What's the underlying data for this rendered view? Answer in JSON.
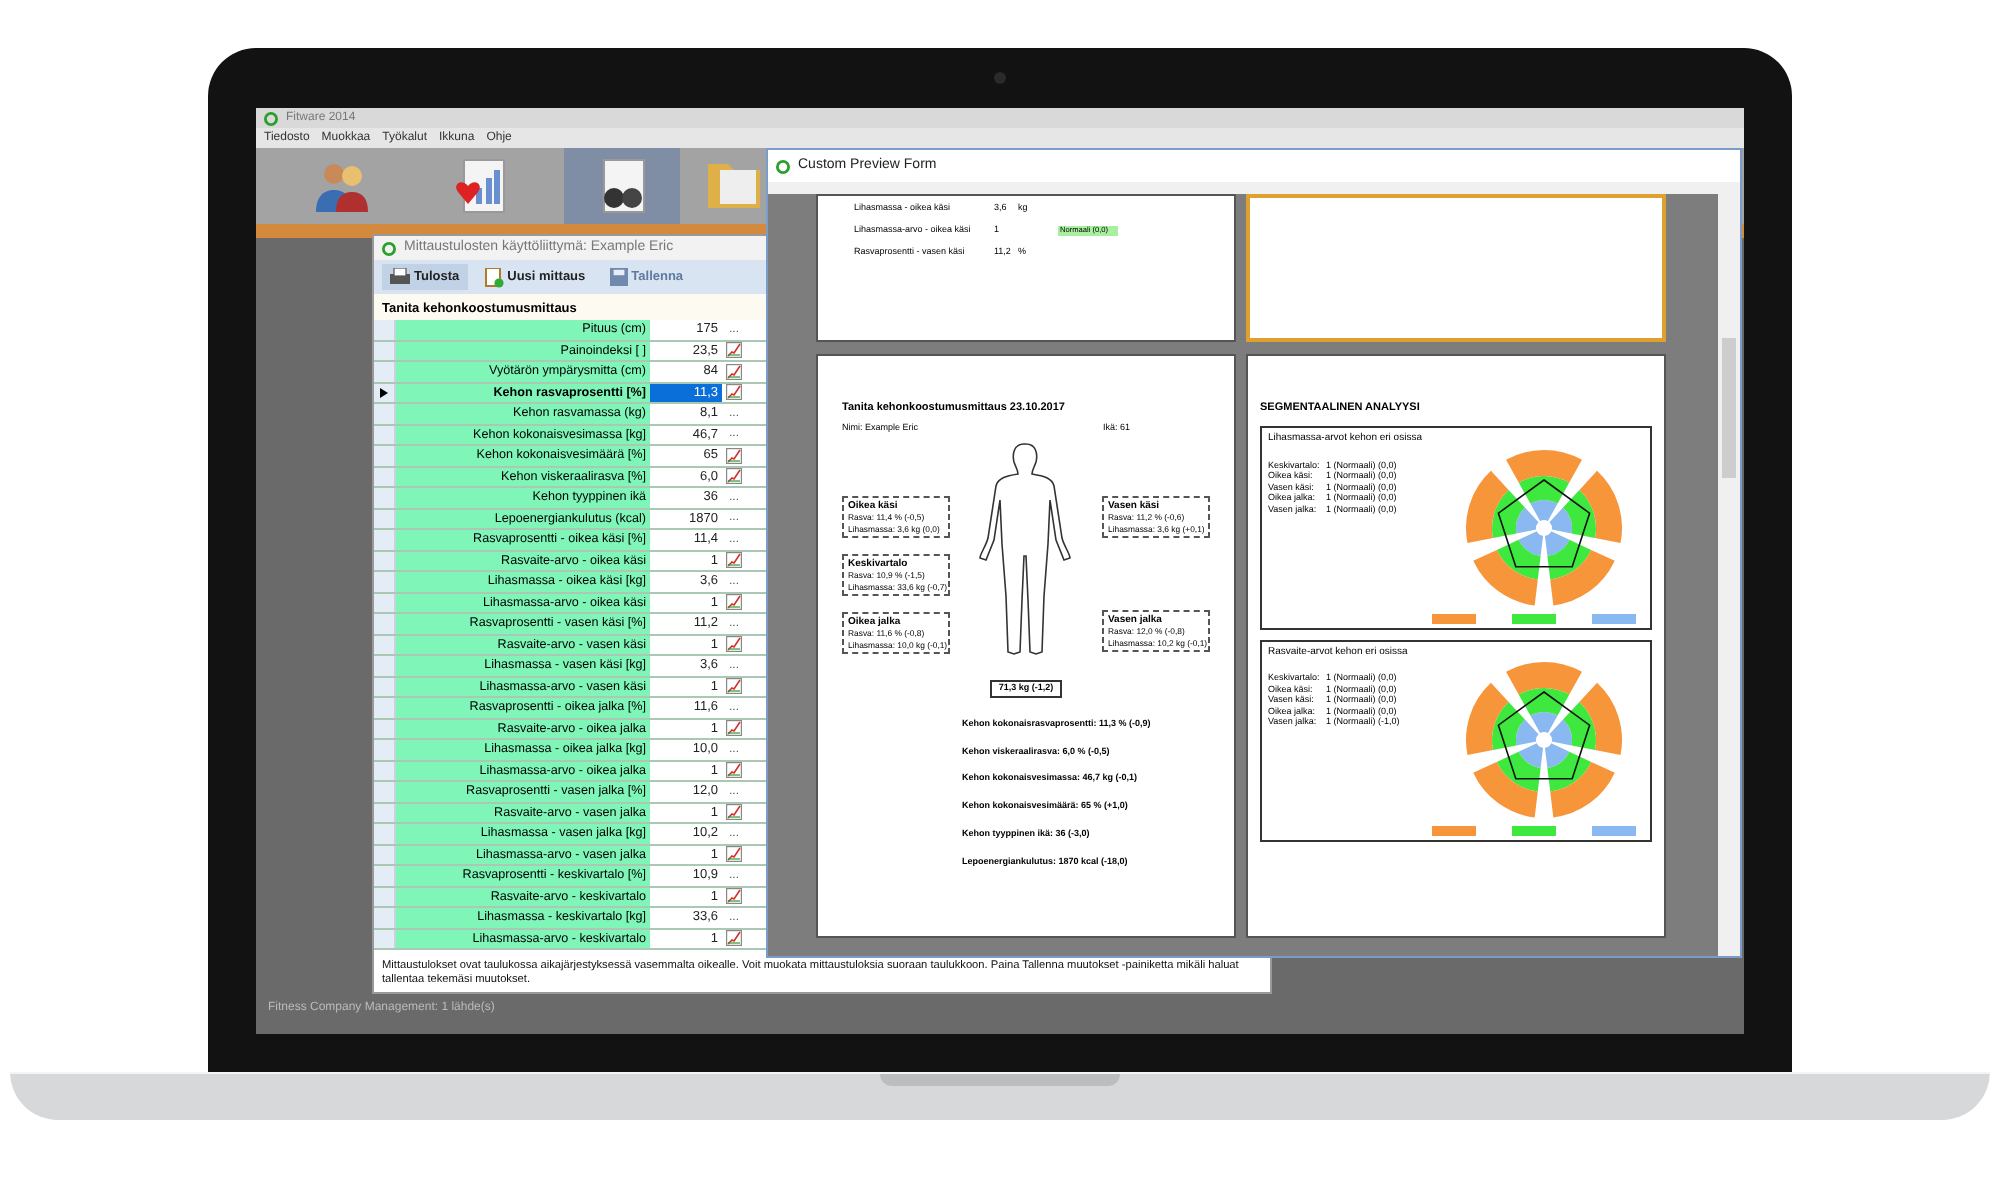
{
  "app": {
    "title": "Fitware 2014",
    "menu": [
      "Tiedosto",
      "Muokkaa",
      "Työkalut",
      "Ikkuna",
      "Ohje"
    ]
  },
  "ribbon": [
    {
      "kind": "people",
      "selected": false
    },
    {
      "kind": "heart-chart",
      "selected": false
    },
    {
      "kind": "weights",
      "selected": true
    },
    {
      "kind": "folder",
      "selected": false
    }
  ],
  "measure_window": {
    "title": "Mittaustulosten käyttöliittymä: Example Eric",
    "toolbar": [
      {
        "kind": "printer",
        "label": "Tulosta",
        "disabled": false
      },
      {
        "kind": "new",
        "label": "Uusi mittaus",
        "disabled": false
      },
      {
        "kind": "save",
        "label": "Tallenna",
        "disabled": true
      }
    ],
    "section": "Tanita kehonkoostumusmittaus",
    "rows": [
      {
        "label": "Pituus (cm)",
        "value": "175",
        "kind": "more",
        "more": "...",
        "selected": false
      },
      {
        "label": "Painoindeksi [ ]",
        "value": "23,5",
        "kind": "chart",
        "selected": false
      },
      {
        "label": "Vyötärön ympärysmitta (cm)",
        "value": "84",
        "kind": "chart",
        "selected": false
      },
      {
        "label": "Kehon rasvaprosentti [%]",
        "value": "11,3",
        "kind": "chart",
        "selected": true
      },
      {
        "label": "Kehon rasvamassa (kg)",
        "value": "8,1",
        "kind": "more",
        "more": "...",
        "selected": false
      },
      {
        "label": "Kehon kokonaisvesimassa [kg]",
        "value": "46,7",
        "kind": "more",
        "more": "...",
        "selected": false
      },
      {
        "label": "Kehon kokonaisvesimäärä [%]",
        "value": "65",
        "kind": "chart",
        "selected": false
      },
      {
        "label": "Kehon viskeraalirasva [%]",
        "value": "6,0",
        "kind": "chart",
        "selected": false
      },
      {
        "label": "Kehon tyyppinen ikä",
        "value": "36",
        "kind": "more",
        "more": "...",
        "selected": false
      },
      {
        "label": "Lepoenergiankulutus (kcal)",
        "value": "1870",
        "kind": "more",
        "more": "...",
        "selected": false
      },
      {
        "label": "Rasvaprosentti - oikea käsi [%]",
        "value": "11,4",
        "kind": "more",
        "more": "...",
        "selected": false
      },
      {
        "label": "Rasvaite-arvo - oikea käsi",
        "value": "1",
        "kind": "chart",
        "selected": false
      },
      {
        "label": "Lihasmassa - oikea käsi [kg]",
        "value": "3,6",
        "kind": "more",
        "more": "...",
        "selected": false
      },
      {
        "label": "Lihasmassa-arvo - oikea käsi",
        "value": "1",
        "kind": "chart",
        "selected": false
      },
      {
        "label": "Rasvaprosentti - vasen käsi [%]",
        "value": "11,2",
        "kind": "more",
        "more": "...",
        "selected": false
      },
      {
        "label": "Rasvaite-arvo - vasen käsi",
        "value": "1",
        "kind": "chart",
        "selected": false
      },
      {
        "label": "Lihasmassa - vasen käsi [kg]",
        "value": "3,6",
        "kind": "more",
        "more": "...",
        "selected": false
      },
      {
        "label": "Lihasmassa-arvo - vasen käsi",
        "value": "1",
        "kind": "chart",
        "selected": false
      },
      {
        "label": "Rasvaprosentti - oikea jalka [%]",
        "value": "11,6",
        "kind": "more",
        "more": "...",
        "selected": false
      },
      {
        "label": "Rasvaite-arvo - oikea jalka",
        "value": "1",
        "kind": "chart",
        "selected": false
      },
      {
        "label": "Lihasmassa - oikea jalka [kg]",
        "value": "10,0",
        "kind": "more",
        "more": "...",
        "selected": false
      },
      {
        "label": "Lihasmassa-arvo - oikea jalka",
        "value": "1",
        "kind": "chart",
        "selected": false
      },
      {
        "label": "Rasvaprosentti - vasen jalka [%]",
        "value": "12,0",
        "kind": "more",
        "more": "...",
        "selected": false
      },
      {
        "label": "Rasvaite-arvo - vasen jalka",
        "value": "1",
        "kind": "chart",
        "selected": false
      },
      {
        "label": "Lihasmassa - vasen jalka [kg]",
        "value": "10,2",
        "kind": "more",
        "more": "...",
        "selected": false
      },
      {
        "label": "Lihasmassa-arvo - vasen jalka",
        "value": "1",
        "kind": "chart",
        "selected": false
      },
      {
        "label": "Rasvaprosentti - keskivartalo [%]",
        "value": "10,9",
        "kind": "more",
        "more": "...",
        "selected": false
      },
      {
        "label": "Rasvaite-arvo - keskivartalo",
        "value": "1",
        "kind": "chart",
        "selected": false
      },
      {
        "label": "Lihasmassa - keskivartalo [kg]",
        "value": "33,6",
        "kind": "more",
        "more": "...",
        "selected": false
      },
      {
        "label": "Lihasmassa-arvo - keskivartalo",
        "value": "1",
        "kind": "chart",
        "selected": false
      }
    ],
    "note": "Mittaustulokset ovat taulukossa aikajärjestyksessä vasemmalta oikealle. Voit muokata mittaustuloksia suoraan taulukkoon. Paina Tallenna muutokset -painiketta mikäli haluat tallentaa tekemäsi muutokset."
  },
  "status_bar": "Fitness Company Management: 1 lähde(s)",
  "preview": {
    "title": "Custom Preview Form",
    "pages": [
      {
        "kind": "table",
        "selected": false,
        "rows": [
          {
            "label": "Lihasmassa - oikea käsi",
            "value": "3,6",
            "unit": "kg"
          },
          {
            "label": "Lihasmassa-arvo - oikea käsi",
            "value": "1",
            "bar": "Normaali (0,0)"
          },
          {
            "label": "Rasvaprosentti - vasen käsi",
            "value": "11,2",
            "unit": "%"
          }
        ]
      },
      {
        "kind": "blank",
        "selected": true
      },
      {
        "kind": "report",
        "selected": false,
        "title": "Tanita kehonkoostumusmittaus 23.10.2017",
        "name": "Nimi: Example Eric",
        "age": "Ikä: 61",
        "left_segments": [
          {
            "title": "Oikea käsi",
            "lines": [
              "Rasva: 11,4 % (-0,5)",
              "Lihasmassa: 3,6 kg (0,0)"
            ]
          },
          {
            "title": "Keskivartalo",
            "lines": [
              "Rasva: 10,9 % (-1,5)",
              "Lihasmassa: 33,6 kg (-0,7)"
            ]
          },
          {
            "title": "Oikea jalka",
            "lines": [
              "Rasva: 11,6 % (-0,8)",
              "Lihasmassa: 10,0 kg (-0,1)"
            ]
          }
        ],
        "right_segments": [
          {
            "title": "Vasen käsi",
            "lines": [
              "Rasva: 11,2 % (-0,6)",
              "Lihasmassa: 3,6 kg (+0,1)"
            ]
          },
          {
            "title": "Vasen jalka",
            "lines": [
              "Rasva: 12,0 % (-0,8)",
              "Lihasmassa: 10,2 kg (-0,1)"
            ]
          }
        ],
        "weight": "71,3 kg (-1,2)",
        "results": [
          "Kehon kokonaisrasvaprosentti: 11,3 % (-0,9)",
          "Kehon viskeraalirasva: 6,0 % (-0,5)",
          "Kehon kokonaisvesimassa: 46,7 kg (-0,1)",
          "Kehon kokonaisvesimäärä: 65 % (+1,0)",
          "Kehon tyyppinen ikä: 36 (-3,0)",
          "Lepoenergiankulutus: 1870 kcal (-18,0)"
        ]
      },
      {
        "kind": "segmental",
        "selected": false,
        "title": "SEGMENTAALINEN ANALYYSI",
        "panels": [
          {
            "title": "Lihasmassa-arvot kehon eri osissa",
            "rows": [
              {
                "part": "Keskivartalo:",
                "value": "1 (Normaali) (0,0)"
              },
              {
                "part": "Oikea käsi:",
                "value": "1 (Normaali) (0,0)"
              },
              {
                "part": "Vasen käsi:",
                "value": "1 (Normaali) (0,0)"
              },
              {
                "part": "Oikea jalka:",
                "value": "1 (Normaali) (0,0)"
              },
              {
                "part": "Vasen jalka:",
                "value": "1 (Normaali) (0,0)"
              }
            ]
          },
          {
            "title": "Rasvaite-arvot kehon eri osissa",
            "rows": [
              {
                "part": "Keskivartalo:",
                "value": "1 (Normaali) (0,0)"
              },
              {
                "part": "Oikea käsi:",
                "value": "1 (Normaali) (0,0)"
              },
              {
                "part": "Vasen käsi:",
                "value": "1 (Normaali) (0,0)"
              },
              {
                "part": "Oikea jalka:",
                "value": "1 (Normaali) (0,0)"
              },
              {
                "part": "Vasen jalka:",
                "value": "1 (Normaali) (-1,0)"
              }
            ]
          }
        ]
      }
    ]
  }
}
